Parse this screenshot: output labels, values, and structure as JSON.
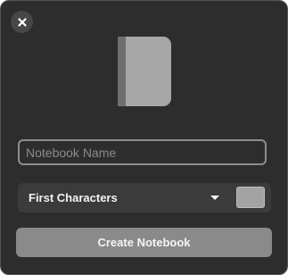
{
  "dialog": {
    "close_icon": "close-icon",
    "notebook_icon": "notebook-icon"
  },
  "name_field": {
    "value": "",
    "placeholder": "Notebook Name"
  },
  "style_select": {
    "selected": "First Characters",
    "caret_icon": "chevron-down-icon"
  },
  "color_picker": {
    "color": "#a3a3a3"
  },
  "create_button": {
    "label": "Create Notebook"
  }
}
